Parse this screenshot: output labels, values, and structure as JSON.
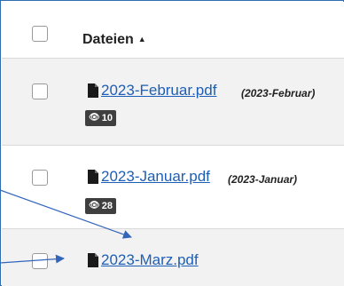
{
  "table": {
    "header": {
      "label": "Dateien",
      "sort_icon": "caret-up-icon"
    },
    "rows": [
      {
        "name": "2023-Februar.pdf",
        "note": "(2023-Februar)",
        "views": "10",
        "icon": "file-icon"
      },
      {
        "name": "2023-Januar.pdf",
        "note": "(2023-Januar)",
        "views": "28",
        "icon": "file-icon"
      },
      {
        "name": "2023-Marz.pdf",
        "icon": "file-icon"
      }
    ]
  },
  "badge_icon": "eye-icon",
  "colors": {
    "link": "#1d5fb6",
    "badge_bg": "#3f3f3f",
    "row_alt_bg": "#f2f2f2",
    "annotation_arrow": "#3366bb"
  }
}
